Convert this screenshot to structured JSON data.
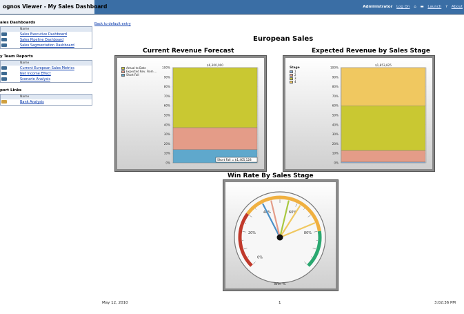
{
  "titlebar": {
    "app_title": "ognos Viewer - My Sales Dashboard",
    "user": "Administrator",
    "log_on": "Log On",
    "launch": "Launch",
    "about": "About"
  },
  "sidebar": {
    "sections": [
      {
        "title": "ales Dashboards",
        "header": "Name",
        "items": [
          "Sales Executive Dashboard",
          "Sales Pipeline Dashboard",
          "Sales Segmentation Dashboard"
        ]
      },
      {
        "title": "y Team Reports",
        "header": "Name",
        "items": [
          "Current European Sales Metrics",
          "Net Income Effect",
          "Scenario Analysis"
        ]
      },
      {
        "title": "port Links",
        "header": "Name",
        "items": [
          "Bank Analysis"
        ]
      }
    ]
  },
  "main": {
    "back_link": "Back to default entry",
    "title": "European Sales"
  },
  "charts": {
    "revenue_forecast": {
      "title": "Current Revenue Forecast"
    },
    "expected_revenue": {
      "title": "Expected Revenue by Sales Stage"
    },
    "win_rate": {
      "title": "Win Rate By Sales Stage"
    }
  },
  "chart_data": [
    {
      "type": "bar",
      "title": "Current Revenue Forecast",
      "stacked": true,
      "percent_scale": true,
      "yticks": [
        "100%",
        "90%",
        "80%",
        "70%",
        "60%",
        "50%",
        "40%",
        "30%",
        "20%",
        "10%",
        "0%"
      ],
      "total_label": "$6,300,000",
      "legend_position": "top-left",
      "series": [
        {
          "name": "Short Fall",
          "value": 14,
          "color": "#5fa8cc"
        },
        {
          "name": "Expected Rev. From ...",
          "value": 23,
          "color": "#e49c88"
        },
        {
          "name": "Actual to Date",
          "value": 63,
          "color": "#c9c832"
        }
      ],
      "tooltip": "Short Fall = $1,405,128"
    },
    {
      "type": "bar",
      "title": "Expected Revenue by Sales Stage",
      "stacked": true,
      "percent_scale": true,
      "yticks": [
        "100%",
        "90%",
        "80%",
        "70%",
        "60%",
        "50%",
        "40%",
        "30%",
        "20%",
        "10%",
        "0%"
      ],
      "total_label": "$1,853,825",
      "legend_title": "Stage",
      "legend_position": "top-left",
      "series": [
        {
          "name": "1",
          "value": 1,
          "color": "#8ab0d8"
        },
        {
          "name": "2",
          "value": 12,
          "color": "#e49c88"
        },
        {
          "name": "3",
          "value": 47,
          "color": "#c9c832"
        },
        {
          "name": "4",
          "value": 40,
          "color": "#f0c860"
        }
      ]
    },
    {
      "type": "gauge",
      "title": "Win Rate By Sales Stage",
      "xlabel": "Win %",
      "scale_labels": [
        "0%",
        "20%",
        "40%",
        "60%",
        "80%"
      ],
      "needles": [
        {
          "value": 40,
          "color": "#4a90c8"
        },
        {
          "value": 45,
          "color": "#e49c88"
        },
        {
          "value": 55,
          "color": "#a8c840"
        },
        {
          "value": 62,
          "color": "#f0c860"
        },
        {
          "value": 75,
          "color": "#f0c860"
        }
      ]
    }
  ],
  "footer": {
    "date": "May 12, 2010",
    "page": "1",
    "time": "3:02:36 PM"
  }
}
